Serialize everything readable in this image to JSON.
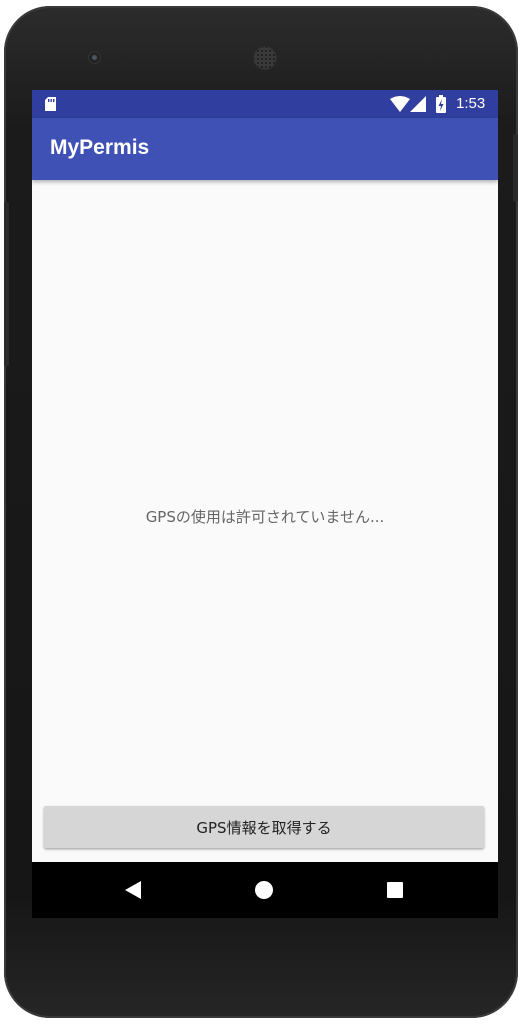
{
  "status_bar": {
    "time": "1:53",
    "icons": [
      "sd-card-icon",
      "wifi-icon",
      "signal-icon",
      "battery-charging-icon"
    ]
  },
  "app_bar": {
    "title": "MyPermis"
  },
  "main": {
    "message": "GPSの使用は許可されていません...",
    "button_label": "GPS情報を取得する"
  },
  "nav_bar": {
    "icons": [
      "back-icon",
      "home-icon",
      "recents-icon"
    ]
  },
  "colors": {
    "status_bar": "#303f9f",
    "app_bar": "#3f51b5",
    "background": "#fafafa",
    "button": "#d6d6d6"
  }
}
